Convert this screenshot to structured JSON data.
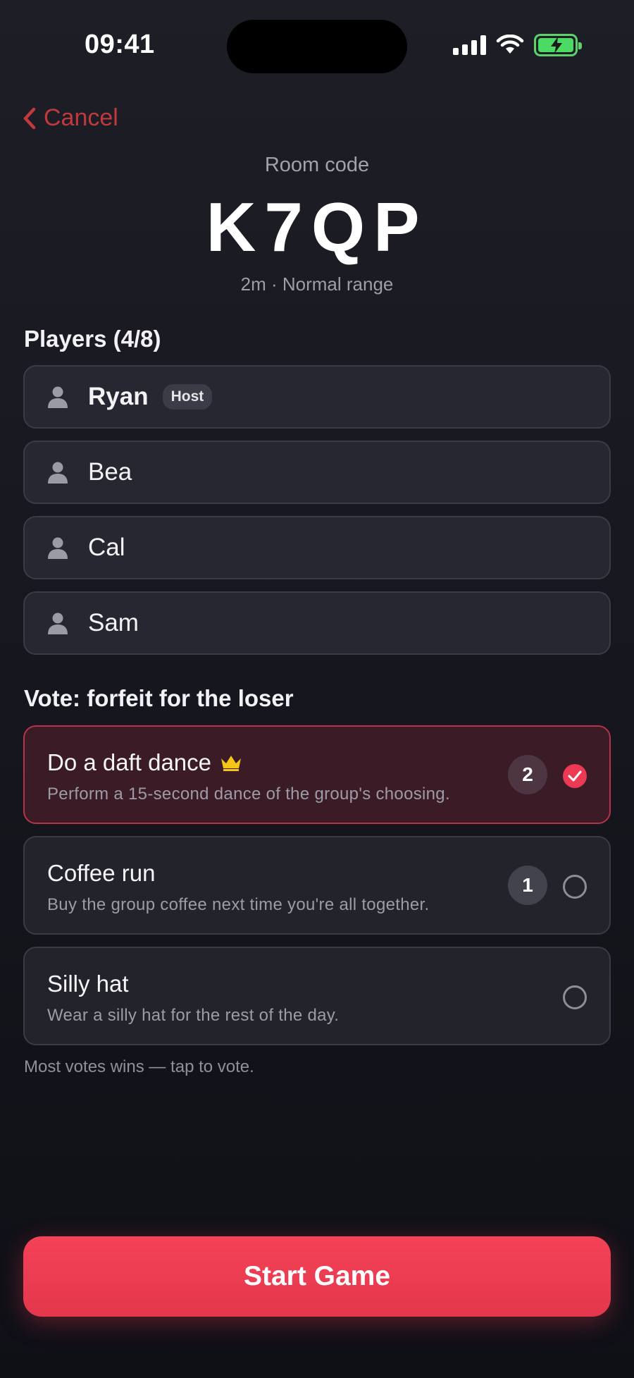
{
  "status": {
    "time": "09:41"
  },
  "header": {
    "cancel_label": "Cancel",
    "room_label": "Room code",
    "room_code": "K7QP",
    "room_meta": "2m · Normal range"
  },
  "players": {
    "title": "Players (4/8)",
    "host_badge": "Host",
    "list": [
      {
        "name": "Ryan"
      },
      {
        "name": "Bea"
      },
      {
        "name": "Cal"
      },
      {
        "name": "Sam"
      }
    ]
  },
  "vote": {
    "title": "Vote: forfeit for the loser",
    "options": [
      {
        "title": "Do a daft dance",
        "desc": "Perform a 15-second dance of the group's choosing.",
        "votes": "2",
        "selected": true,
        "leading": true
      },
      {
        "title": "Coffee run",
        "desc": "Buy the group coffee next time you're all together.",
        "votes": "1",
        "selected": false,
        "leading": false
      },
      {
        "title": "Silly hat",
        "desc": "Wear a silly hat for the rest of the day.",
        "votes": "",
        "selected": false,
        "leading": false
      }
    ],
    "hint": "Most votes wins — tap to vote."
  },
  "start_label": "Start Game",
  "colors": {
    "accent": "#ec3a55",
    "cancel": "#c2393d",
    "battery": "#4cd964",
    "crown": "#f5c518"
  },
  "icons": {
    "leader": "crown-icon",
    "player": "person-icon",
    "back": "chevron-left-icon"
  }
}
